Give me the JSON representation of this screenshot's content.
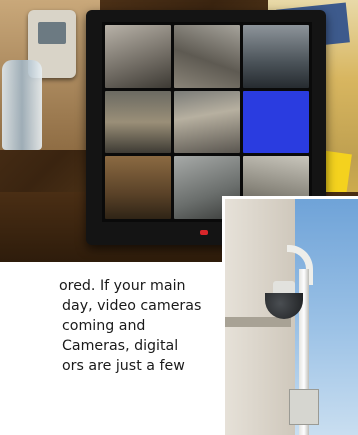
{
  "article": {
    "lines": [
      "ored. If your main",
      "day, video cameras",
      "coming and",
      "Cameras, digital",
      "ors are just a few"
    ]
  },
  "monitor_photo": {
    "screen_tiles": 9,
    "highlight_tile_color": "#2a3ce0"
  },
  "dome_camera_photo": {
    "sky_color": "#9cc2e6"
  }
}
